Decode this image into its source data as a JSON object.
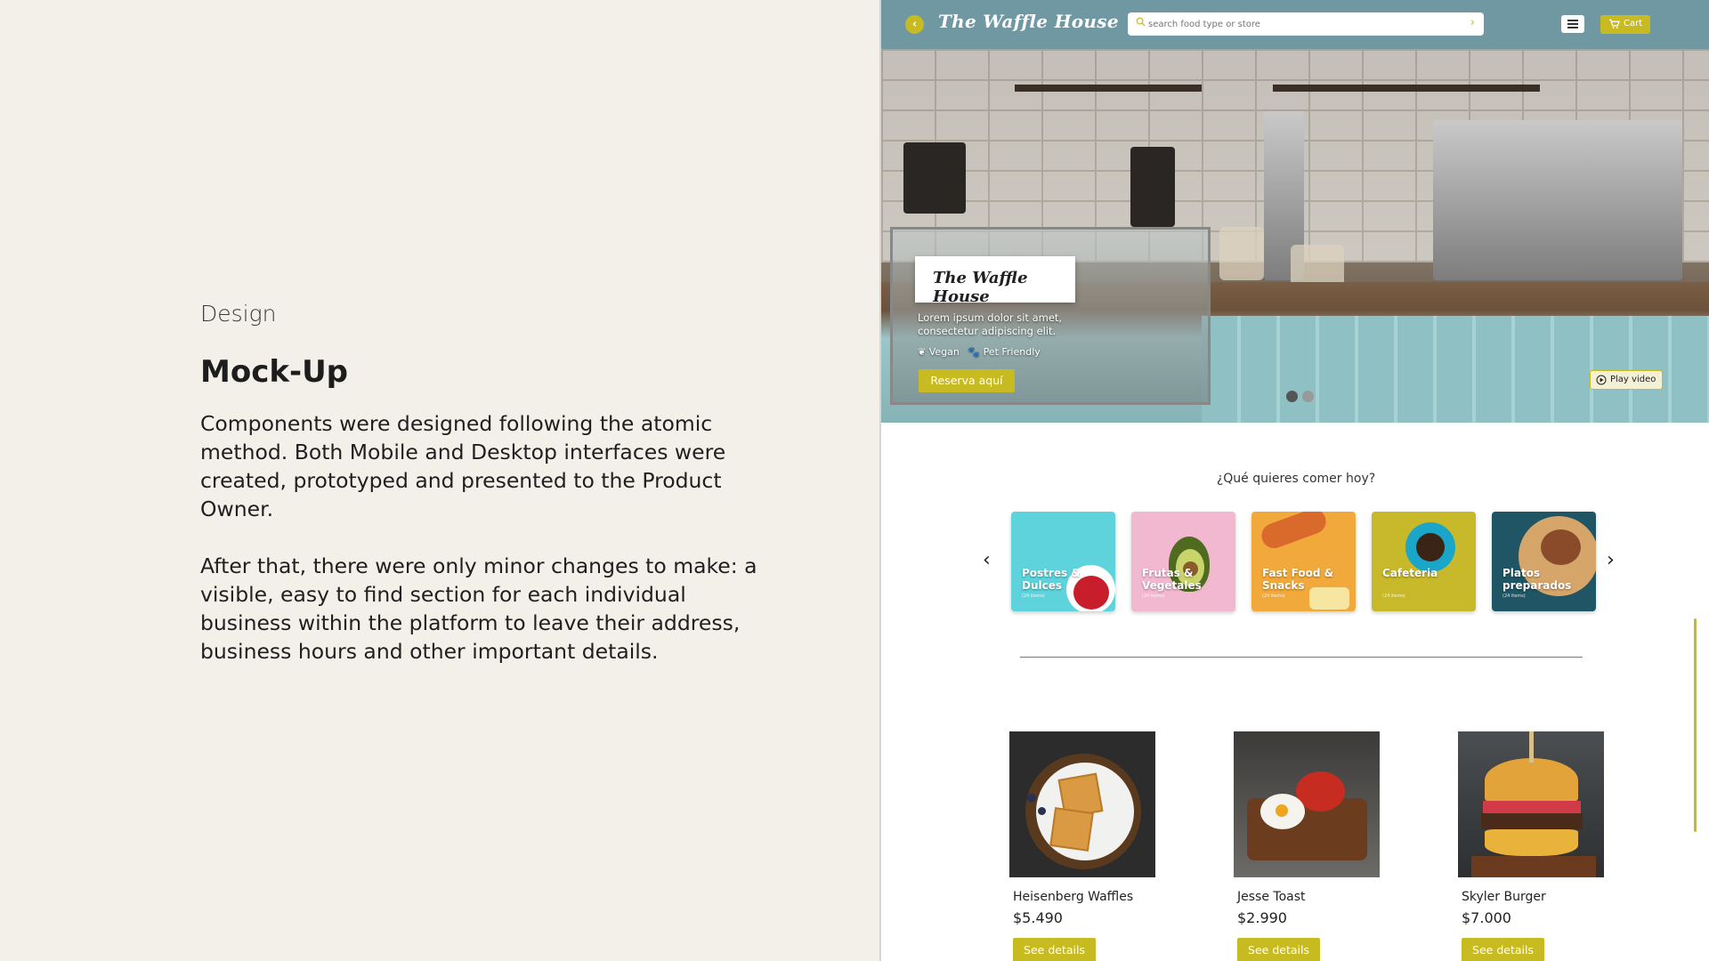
{
  "left": {
    "eyebrow": "Design",
    "title": "Mock-Up",
    "paragraph1": "Components were designed following the atomic method. Both Mobile and Desktop interfaces were created, prototyped and presented to the Product Owner.",
    "paragraph2": "After that, there were only minor changes to make: a visible, easy to find section for each individual business within the platform to leave their address, business hours and other important details."
  },
  "mockup": {
    "brand": "The Waffle House",
    "search": {
      "placeholder": "search food type or store"
    },
    "cart_label": "Cart",
    "accent_color": "#c7bb21",
    "topbar_color": "#6f98a2",
    "hero": {
      "card_title": "The Waffle House",
      "text": "Lorem ipsum dolor sit amet, consectetur adipiscing elit.",
      "tags": [
        "Vegan",
        "Pet Friendly"
      ],
      "reserve_label": "Reserva aquí",
      "play_label": "Play video"
    },
    "question": "¿Qué quieres comer hoy?",
    "categories": [
      {
        "label": "Postres & Dulces",
        "count": "(24 items)",
        "color": "#5fd3dc"
      },
      {
        "label": "Frutas & Vegetales",
        "count": "(24 items)",
        "color": "#f2b8cf"
      },
      {
        "label": "Fast Food & Snacks",
        "count": "(24 items)",
        "color": "#f2a93b"
      },
      {
        "label": "Cafeteria",
        "count": "(24 items)",
        "color": "#c7b92a"
      },
      {
        "label": "Platos preparados",
        "count": "(24 items)",
        "color": "#1f5564"
      }
    ],
    "products": [
      {
        "name": "Heisenberg Waffles",
        "price": "$5.490",
        "button": "See details"
      },
      {
        "name": "Jesse Toast",
        "price": "$2.990",
        "button": "See details"
      },
      {
        "name": "Skyler Burger",
        "price": "$7.000",
        "button": "See details"
      }
    ]
  }
}
